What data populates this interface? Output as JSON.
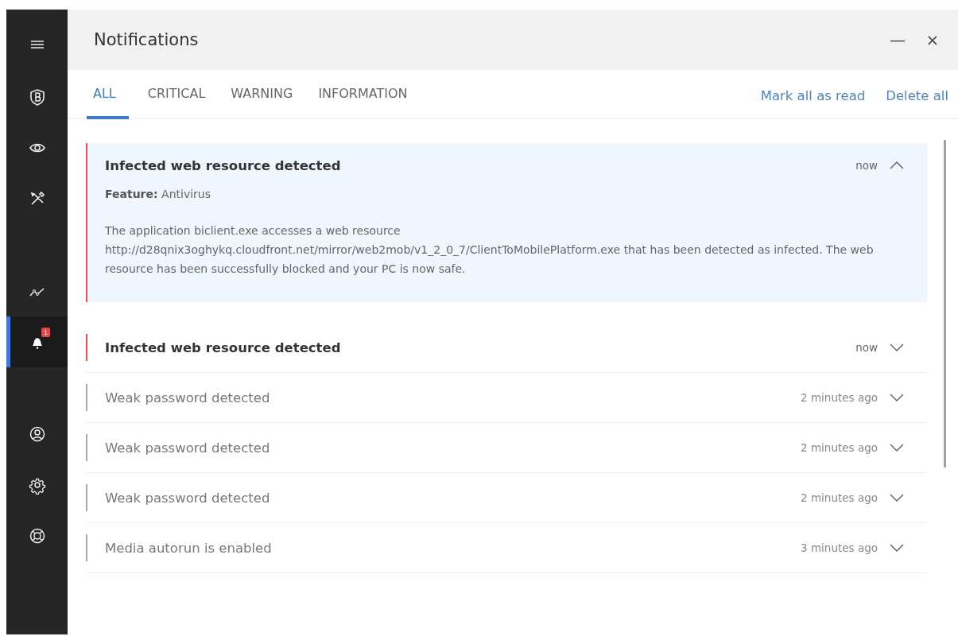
{
  "sidebar": {
    "items": [
      {
        "kind": "menu",
        "selected": false
      },
      {
        "kind": "shield",
        "selected": false
      },
      {
        "kind": "eye",
        "selected": false
      },
      {
        "kind": "tools",
        "selected": false
      },
      {
        "kind": "chart",
        "selected": false
      },
      {
        "kind": "bell",
        "selected": true,
        "badge": "1"
      },
      {
        "kind": "user",
        "selected": false
      },
      {
        "kind": "gear",
        "selected": false
      },
      {
        "kind": "lifebuoy",
        "selected": false
      }
    ]
  },
  "window": {
    "title": "Notifications",
    "minimize": "—",
    "close": "×"
  },
  "tabs": [
    {
      "label": "ALL",
      "selected": true
    },
    {
      "label": "CRITICAL",
      "selected": false
    },
    {
      "label": "WARNING",
      "selected": false
    },
    {
      "label": "INFORMATION",
      "selected": false
    }
  ],
  "actions": [
    "Mark all as read",
    "Delete all"
  ],
  "notifications": [
    {
      "title": "Infected web resource detected",
      "kind": "critical",
      "time": "now",
      "expanded": true,
      "feature": "**Feature:** Antivirus",
      "message": "The application biclient.exe accesses a web resource http://d28qnix3oghykq.cloudfront.net/mirror/web2mob/v1_2_0_7/ClientToMobilePlatform.exe  that has been detected as infected. The web resource has been successfully blocked and your PC is now safe."
    },
    {
      "title": "Infected web resource detected",
      "kind": "critical",
      "time": "now",
      "expanded": false
    },
    {
      "title": "Weak password detected",
      "kind": "warning",
      "time": "2 minutes ago",
      "expanded": false
    },
    {
      "title": "Weak password detected",
      "kind": "warning",
      "time": "2 minutes ago",
      "expanded": false
    },
    {
      "title": "Weak password detected",
      "kind": "warning",
      "time": "2 minutes ago",
      "expanded": false
    },
    {
      "title": "Media autorun is enabled",
      "kind": "warning",
      "time": "3 minutes ago",
      "expanded": false
    }
  ]
}
